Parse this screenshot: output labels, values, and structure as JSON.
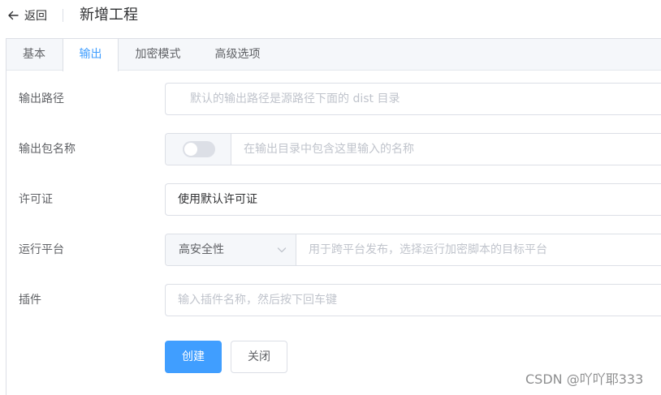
{
  "header": {
    "back_label": "返回",
    "title": "新增工程"
  },
  "tabs": [
    {
      "label": "基本",
      "active": false
    },
    {
      "label": "输出",
      "active": true
    },
    {
      "label": "加密模式",
      "active": false
    },
    {
      "label": "高级选项",
      "active": false
    }
  ],
  "form": {
    "output_path": {
      "label": "输出路径",
      "value": "",
      "placeholder": "默认的输出路径是源路径下面的 dist 目录"
    },
    "package_name": {
      "label": "输出包名称",
      "switch_on": false,
      "placeholder": "在输出目录中包含这里输入的名称"
    },
    "license": {
      "label": "许可证",
      "value": "使用默认许可证"
    },
    "platform": {
      "label": "运行平台",
      "selected": "高安全性",
      "placeholder": "用于跨平台发布，选择运行加密脚本的目标平台"
    },
    "plugins": {
      "label": "插件",
      "placeholder": "输入插件名称，然后按下回车键"
    }
  },
  "buttons": {
    "create": "创建",
    "close": "关闭"
  },
  "watermark": "CSDN @吖吖耶333",
  "colors": {
    "primary": "#409eff",
    "border": "#dcdfe6",
    "placeholder": "#c0c4cc",
    "tab_bg": "#f5f7fa"
  }
}
